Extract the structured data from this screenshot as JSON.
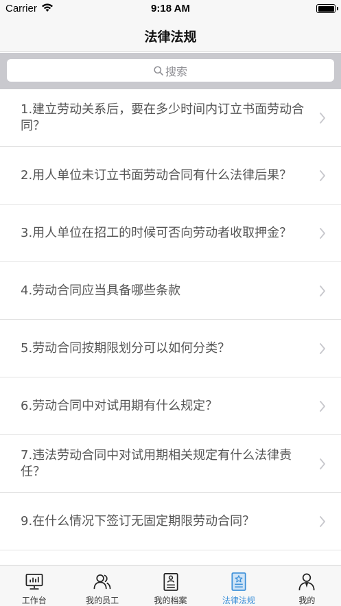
{
  "status_bar": {
    "carrier": "Carrier",
    "time": "9:18 AM"
  },
  "nav": {
    "title": "法律法规"
  },
  "search": {
    "placeholder": "搜索"
  },
  "list": [
    {
      "text": "1.建立劳动关系后，要在多少时间内订立书面劳动合同？"
    },
    {
      "text": "2.用人单位未订立书面劳动合同有什么法律后果？"
    },
    {
      "text": "3.用人单位在招工的时候可否向劳动者收取押金？"
    },
    {
      "text": "4.劳动合同应当具备哪些条款"
    },
    {
      "text": "5.劳动合同按期限划分可以如何分类？"
    },
    {
      "text": "6.劳动合同中对试用期有什么规定？"
    },
    {
      "text": "7.违法劳动合同中对试用期相关规定有什么法律责任？"
    },
    {
      "text": "9.在什么情况下签订无固定期限劳动合同？"
    }
  ],
  "tabs": [
    {
      "label": "工作台",
      "icon": "monitor-icon",
      "active": false
    },
    {
      "label": "我的员工",
      "icon": "people-icon",
      "active": false
    },
    {
      "label": "我的档案",
      "icon": "document-icon",
      "active": false
    },
    {
      "label": "法律法规",
      "icon": "law-book-icon",
      "active": true
    },
    {
      "label": "我的",
      "icon": "person-icon",
      "active": false
    }
  ],
  "colors": {
    "accent": "#3b8fd8",
    "search_bg": "#c9c9ce",
    "bar_bg": "#f7f7f7"
  }
}
